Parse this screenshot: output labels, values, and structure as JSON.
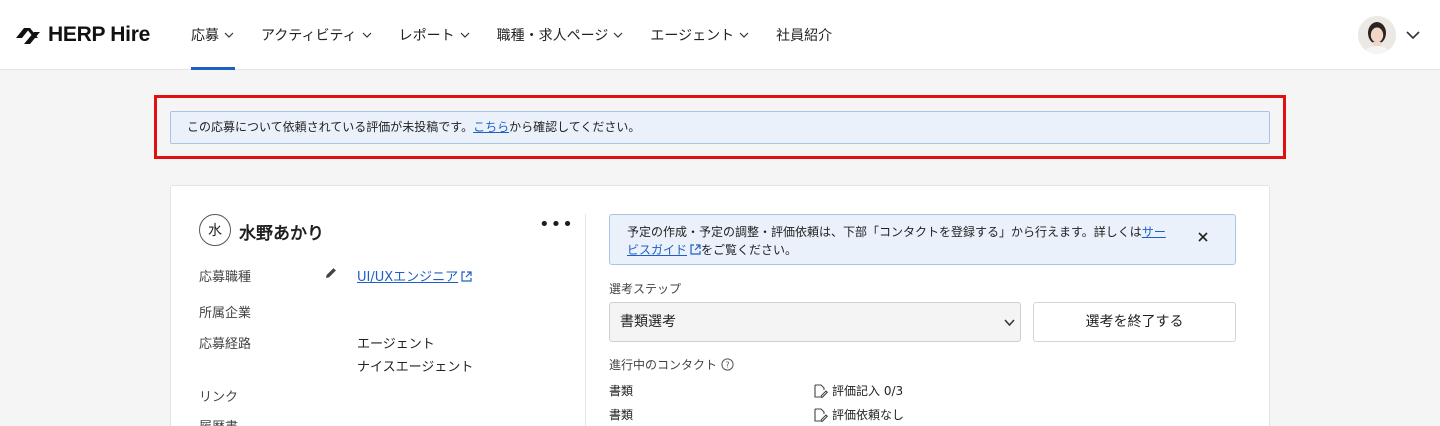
{
  "header": {
    "logo_text": "HERP Hire",
    "nav": [
      {
        "label": "応募",
        "has_menu": true,
        "active": true
      },
      {
        "label": "アクティビティ",
        "has_menu": true,
        "active": false
      },
      {
        "label": "レポート",
        "has_menu": true,
        "active": false
      },
      {
        "label": "職種・求人ページ",
        "has_menu": true,
        "active": false
      },
      {
        "label": "エージェント",
        "has_menu": true,
        "active": false
      },
      {
        "label": "社員紹介",
        "has_menu": false,
        "active": false
      }
    ]
  },
  "alert": {
    "text_before": "この応募について依頼されている評価が未投稿です。",
    "link": "こちら",
    "text_after": "から確認してください。"
  },
  "candidate": {
    "avatar_char": "水",
    "name": "水野あかり",
    "more": "•••",
    "fields": {
      "position_label": "応募職種",
      "position_value": "UI/UXエンジニア",
      "company_label": "所属企業",
      "route_label": "応募経路",
      "route_value_1": "エージェント",
      "route_value_2": "ナイスエージェント",
      "link_label": "リンク",
      "resume_label": "履歴書"
    }
  },
  "info": {
    "line1_before": "予定の作成・予定の調整・評価依頼は、下部「コンタクトを登録する」から行えます。詳しくは",
    "link_part1": "サー",
    "link_part2": "ビスガイド",
    "line2_after": "をご覧ください。"
  },
  "selection": {
    "step_label": "選考ステップ",
    "selected_step": "書類選考",
    "end_button": "選考を終了する"
  },
  "contacts": {
    "label": "進行中のコンタクト",
    "rows": [
      {
        "type": "書類",
        "status": "評価記入 0/3"
      },
      {
        "type": "書類",
        "status": "評価依頼なし"
      }
    ]
  },
  "colors": {
    "accent": "#1e5fc4",
    "alert_bg": "#eaf1fa",
    "alert_border": "#a9c4e6",
    "highlight": "#e01010"
  }
}
